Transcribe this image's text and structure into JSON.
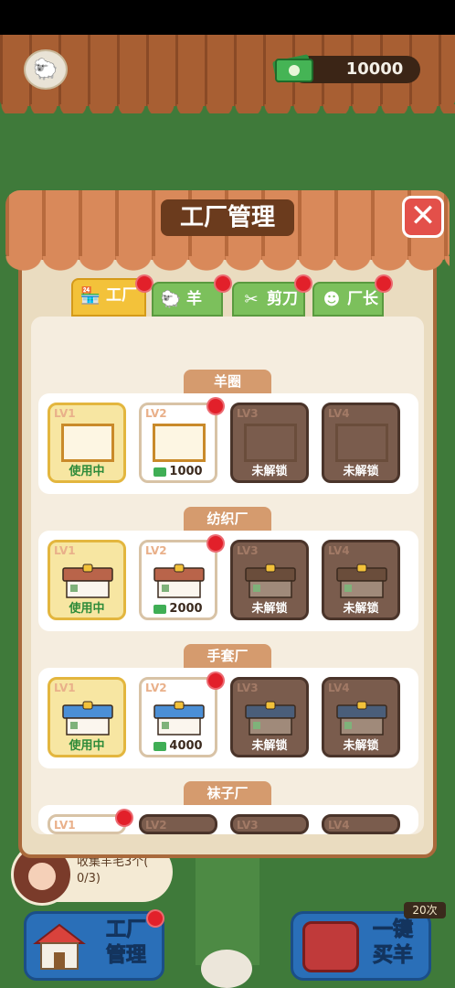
{
  "hud": {
    "money": "10000"
  },
  "modal": {
    "title": "工厂管理",
    "tabs": [
      {
        "label": "工厂",
        "icon": "shop-icon"
      },
      {
        "label": "羊",
        "icon": "sheep-icon"
      },
      {
        "label": "剪刀",
        "icon": "scissors-icon"
      },
      {
        "label": "厂长",
        "icon": "manager-icon"
      }
    ],
    "sections": [
      {
        "name": "羊圈",
        "cards": [
          {
            "level": "LV1",
            "status": "使用中",
            "state": "inuse"
          },
          {
            "level": "LV2",
            "price": "1000",
            "state": "buy"
          },
          {
            "level": "LV3",
            "status": "未解锁",
            "state": "locked"
          },
          {
            "level": "LV4",
            "status": "未解锁",
            "state": "locked"
          }
        ]
      },
      {
        "name": "纺织厂",
        "cards": [
          {
            "level": "LV1",
            "status": "使用中",
            "state": "inuse"
          },
          {
            "level": "LV2",
            "price": "2000",
            "state": "buy"
          },
          {
            "level": "LV3",
            "status": "未解锁",
            "state": "locked"
          },
          {
            "level": "LV4",
            "status": "未解锁",
            "state": "locked"
          }
        ]
      },
      {
        "name": "手套厂",
        "cards": [
          {
            "level": "LV1",
            "status": "使用中",
            "state": "inuse"
          },
          {
            "level": "LV2",
            "price": "4000",
            "state": "buy"
          },
          {
            "level": "LV3",
            "status": "未解锁",
            "state": "locked"
          },
          {
            "level": "LV4",
            "status": "未解锁",
            "state": "locked"
          }
        ]
      },
      {
        "name": "袜子厂",
        "cards": [
          {
            "level": "LV1"
          },
          {
            "level": "LV2"
          },
          {
            "level": "LV3"
          },
          {
            "level": "LV4"
          }
        ]
      }
    ]
  },
  "player": {
    "task_line1": "收集羊毛3个(",
    "task_line2": "0/3)"
  },
  "buttons": {
    "factory_line1": "工厂",
    "factory_line2": "管理",
    "buy_line1": "一键",
    "buy_line2": "买羊",
    "buy_count": "20次"
  }
}
